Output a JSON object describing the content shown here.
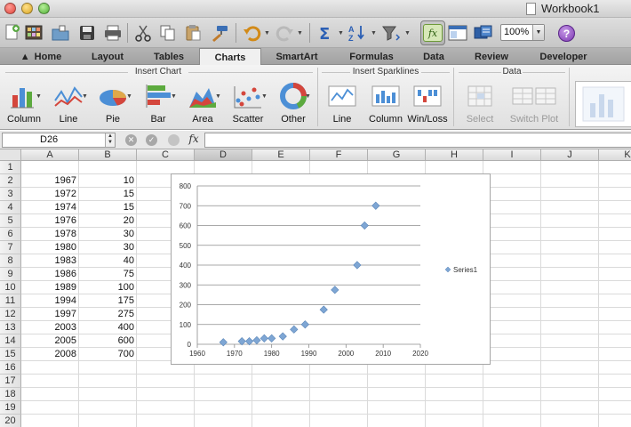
{
  "window": {
    "title": "Workbook1"
  },
  "toolbar": {
    "zoom": "100%",
    "icons": [
      "new-icon",
      "gallery-icon",
      "open-icon",
      "save-icon",
      "print-icon",
      "cut-icon",
      "copy-icon",
      "paste-icon",
      "format-painter-icon",
      "undo-icon",
      "redo-icon",
      "autosum-icon",
      "sort-icon",
      "filter-icon",
      "formula-builder-icon",
      "show-hide-icon",
      "toolbox-icon",
      "help-icon"
    ],
    "formula_builder_label": "fx",
    "help_label": "?"
  },
  "ribbon": {
    "tabs": [
      {
        "label": "Home"
      },
      {
        "label": "Layout"
      },
      {
        "label": "Tables"
      },
      {
        "label": "Charts",
        "active": true
      },
      {
        "label": "SmartArt"
      },
      {
        "label": "Formulas"
      },
      {
        "label": "Data"
      },
      {
        "label": "Review"
      },
      {
        "label": "Developer"
      }
    ],
    "groups": {
      "insert_chart": {
        "title": "Insert Chart",
        "buttons": [
          "Column",
          "Line",
          "Pie",
          "Bar",
          "Area",
          "Scatter",
          "Other"
        ]
      },
      "insert_sparklines": {
        "title": "Insert Sparklines",
        "buttons": [
          "Line",
          "Column",
          "Win/Loss"
        ]
      },
      "data": {
        "title": "Data",
        "buttons": [
          "Select",
          "Switch Plot"
        ]
      }
    }
  },
  "formula_bar": {
    "name_box": "D26",
    "fx_label": "fx",
    "content": ""
  },
  "sheet": {
    "columns": [
      "A",
      "B",
      "C",
      "D",
      "E",
      "F",
      "G",
      "H",
      "I",
      "J",
      "K"
    ],
    "selected_column": "D",
    "rows": [
      "1",
      "2",
      "3",
      "4",
      "5",
      "6",
      "7",
      "8",
      "9",
      "10",
      "11",
      "12",
      "13",
      "14",
      "15",
      "16",
      "17",
      "18",
      "19",
      "20"
    ],
    "data": [
      {
        "row": "2",
        "A": "1967",
        "B": "10"
      },
      {
        "row": "3",
        "A": "1972",
        "B": "15"
      },
      {
        "row": "4",
        "A": "1974",
        "B": "15"
      },
      {
        "row": "5",
        "A": "1976",
        "B": "20"
      },
      {
        "row": "6",
        "A": "1978",
        "B": "30"
      },
      {
        "row": "7",
        "A": "1980",
        "B": "30"
      },
      {
        "row": "8",
        "A": "1983",
        "B": "40"
      },
      {
        "row": "9",
        "A": "1986",
        "B": "75"
      },
      {
        "row": "10",
        "A": "1989",
        "B": "100"
      },
      {
        "row": "11",
        "A": "1994",
        "B": "175"
      },
      {
        "row": "12",
        "A": "1997",
        "B": "275"
      },
      {
        "row": "13",
        "A": "2003",
        "B": "400"
      },
      {
        "row": "14",
        "A": "2005",
        "B": "600"
      },
      {
        "row": "15",
        "A": "2008",
        "B": "700"
      }
    ]
  },
  "chart_data": {
    "type": "scatter",
    "title": "",
    "xlabel": "",
    "ylabel": "",
    "xlim": [
      1960,
      2020
    ],
    "ylim": [
      0,
      800
    ],
    "x_ticks": [
      "1960",
      "1970",
      "1980",
      "1990",
      "2000",
      "2010",
      "2020"
    ],
    "y_ticks": [
      "0",
      "100",
      "200",
      "300",
      "400",
      "500",
      "600",
      "700",
      "800"
    ],
    "grid": "horizontal",
    "legend_position": "right",
    "marker_color": "#7ea6d4",
    "series": [
      {
        "name": "Series1",
        "x": [
          1967,
          1972,
          1974,
          1976,
          1978,
          1980,
          1983,
          1986,
          1989,
          1994,
          1997,
          2003,
          2005,
          2008
        ],
        "y": [
          10,
          15,
          15,
          20,
          30,
          30,
          40,
          75,
          100,
          175,
          275,
          400,
          600,
          700
        ]
      }
    ]
  }
}
